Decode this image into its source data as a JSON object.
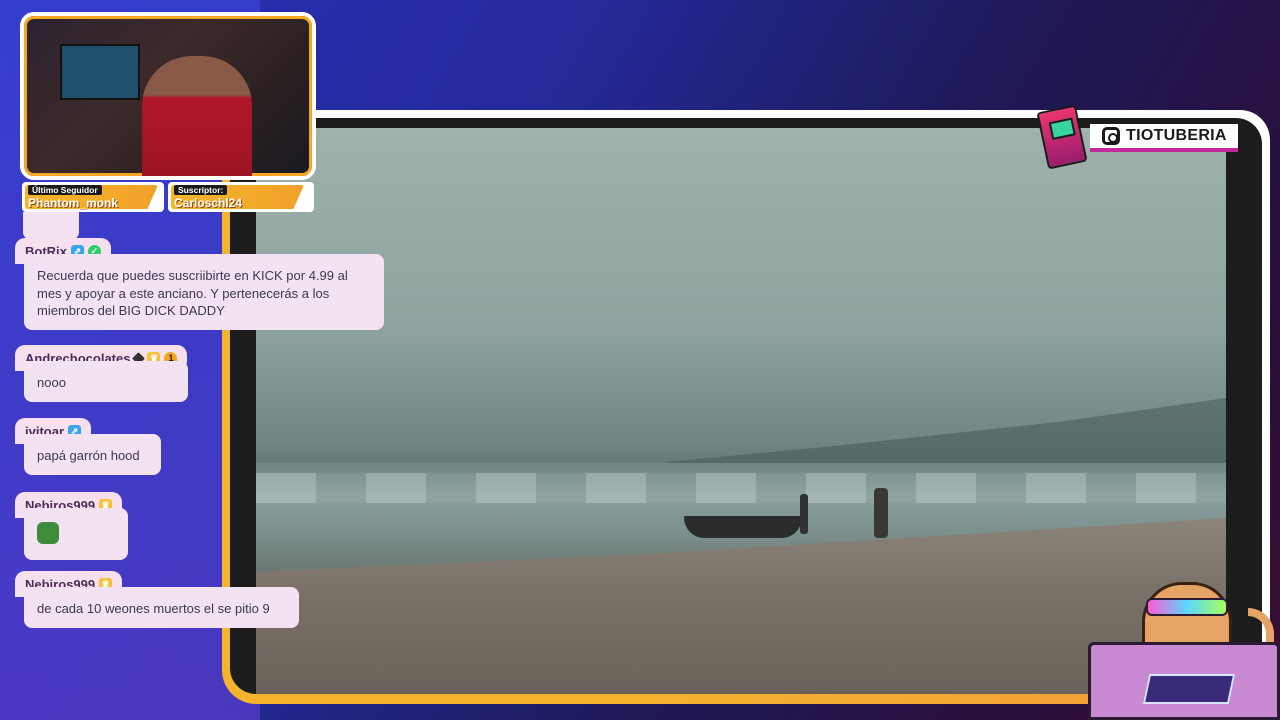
{
  "colors": {
    "accent_orange": "#f5b32d",
    "chat_bubble": "#f3e2f2",
    "instagram_underline": "#c02a9c"
  },
  "social": {
    "icon": "instagram-icon",
    "handle": "TIOTUBERIA"
  },
  "stats": {
    "follower": {
      "label": "Último Seguidor",
      "value": "Phantom_monk"
    },
    "subscriber": {
      "label": "Suscriptor:",
      "value": "Carloschl24"
    }
  },
  "chat": {
    "messages": [
      {
        "user": "BotRix",
        "badges": [
          "bot-badge-icon",
          "verified-badge-icon"
        ],
        "text": "Recuerda que puedes suscriibirte en KICK por 4.99 al mes y apoyar a este anciano. Y pertenecerás a los miembros del BIG DICK DADDY"
      },
      {
        "user": "Andrechocolates",
        "badges": [
          "diamond-badge-icon",
          "crown-badge-icon",
          "number-badge-icon"
        ],
        "badge_number": "1",
        "text": "nooo"
      },
      {
        "user": "ivitoar",
        "badges": [
          "bot-badge-icon"
        ],
        "text": "papá garrón hood"
      },
      {
        "user": "Nebiros999",
        "badges": [
          "crown-badge-icon"
        ],
        "text": "",
        "emote": "pepe-emote-icon"
      },
      {
        "user": "Nebiros999",
        "badges": [
          "crown-badge-icon"
        ],
        "text": "de cada 10 weones muertos el se pitio 9"
      }
    ]
  }
}
